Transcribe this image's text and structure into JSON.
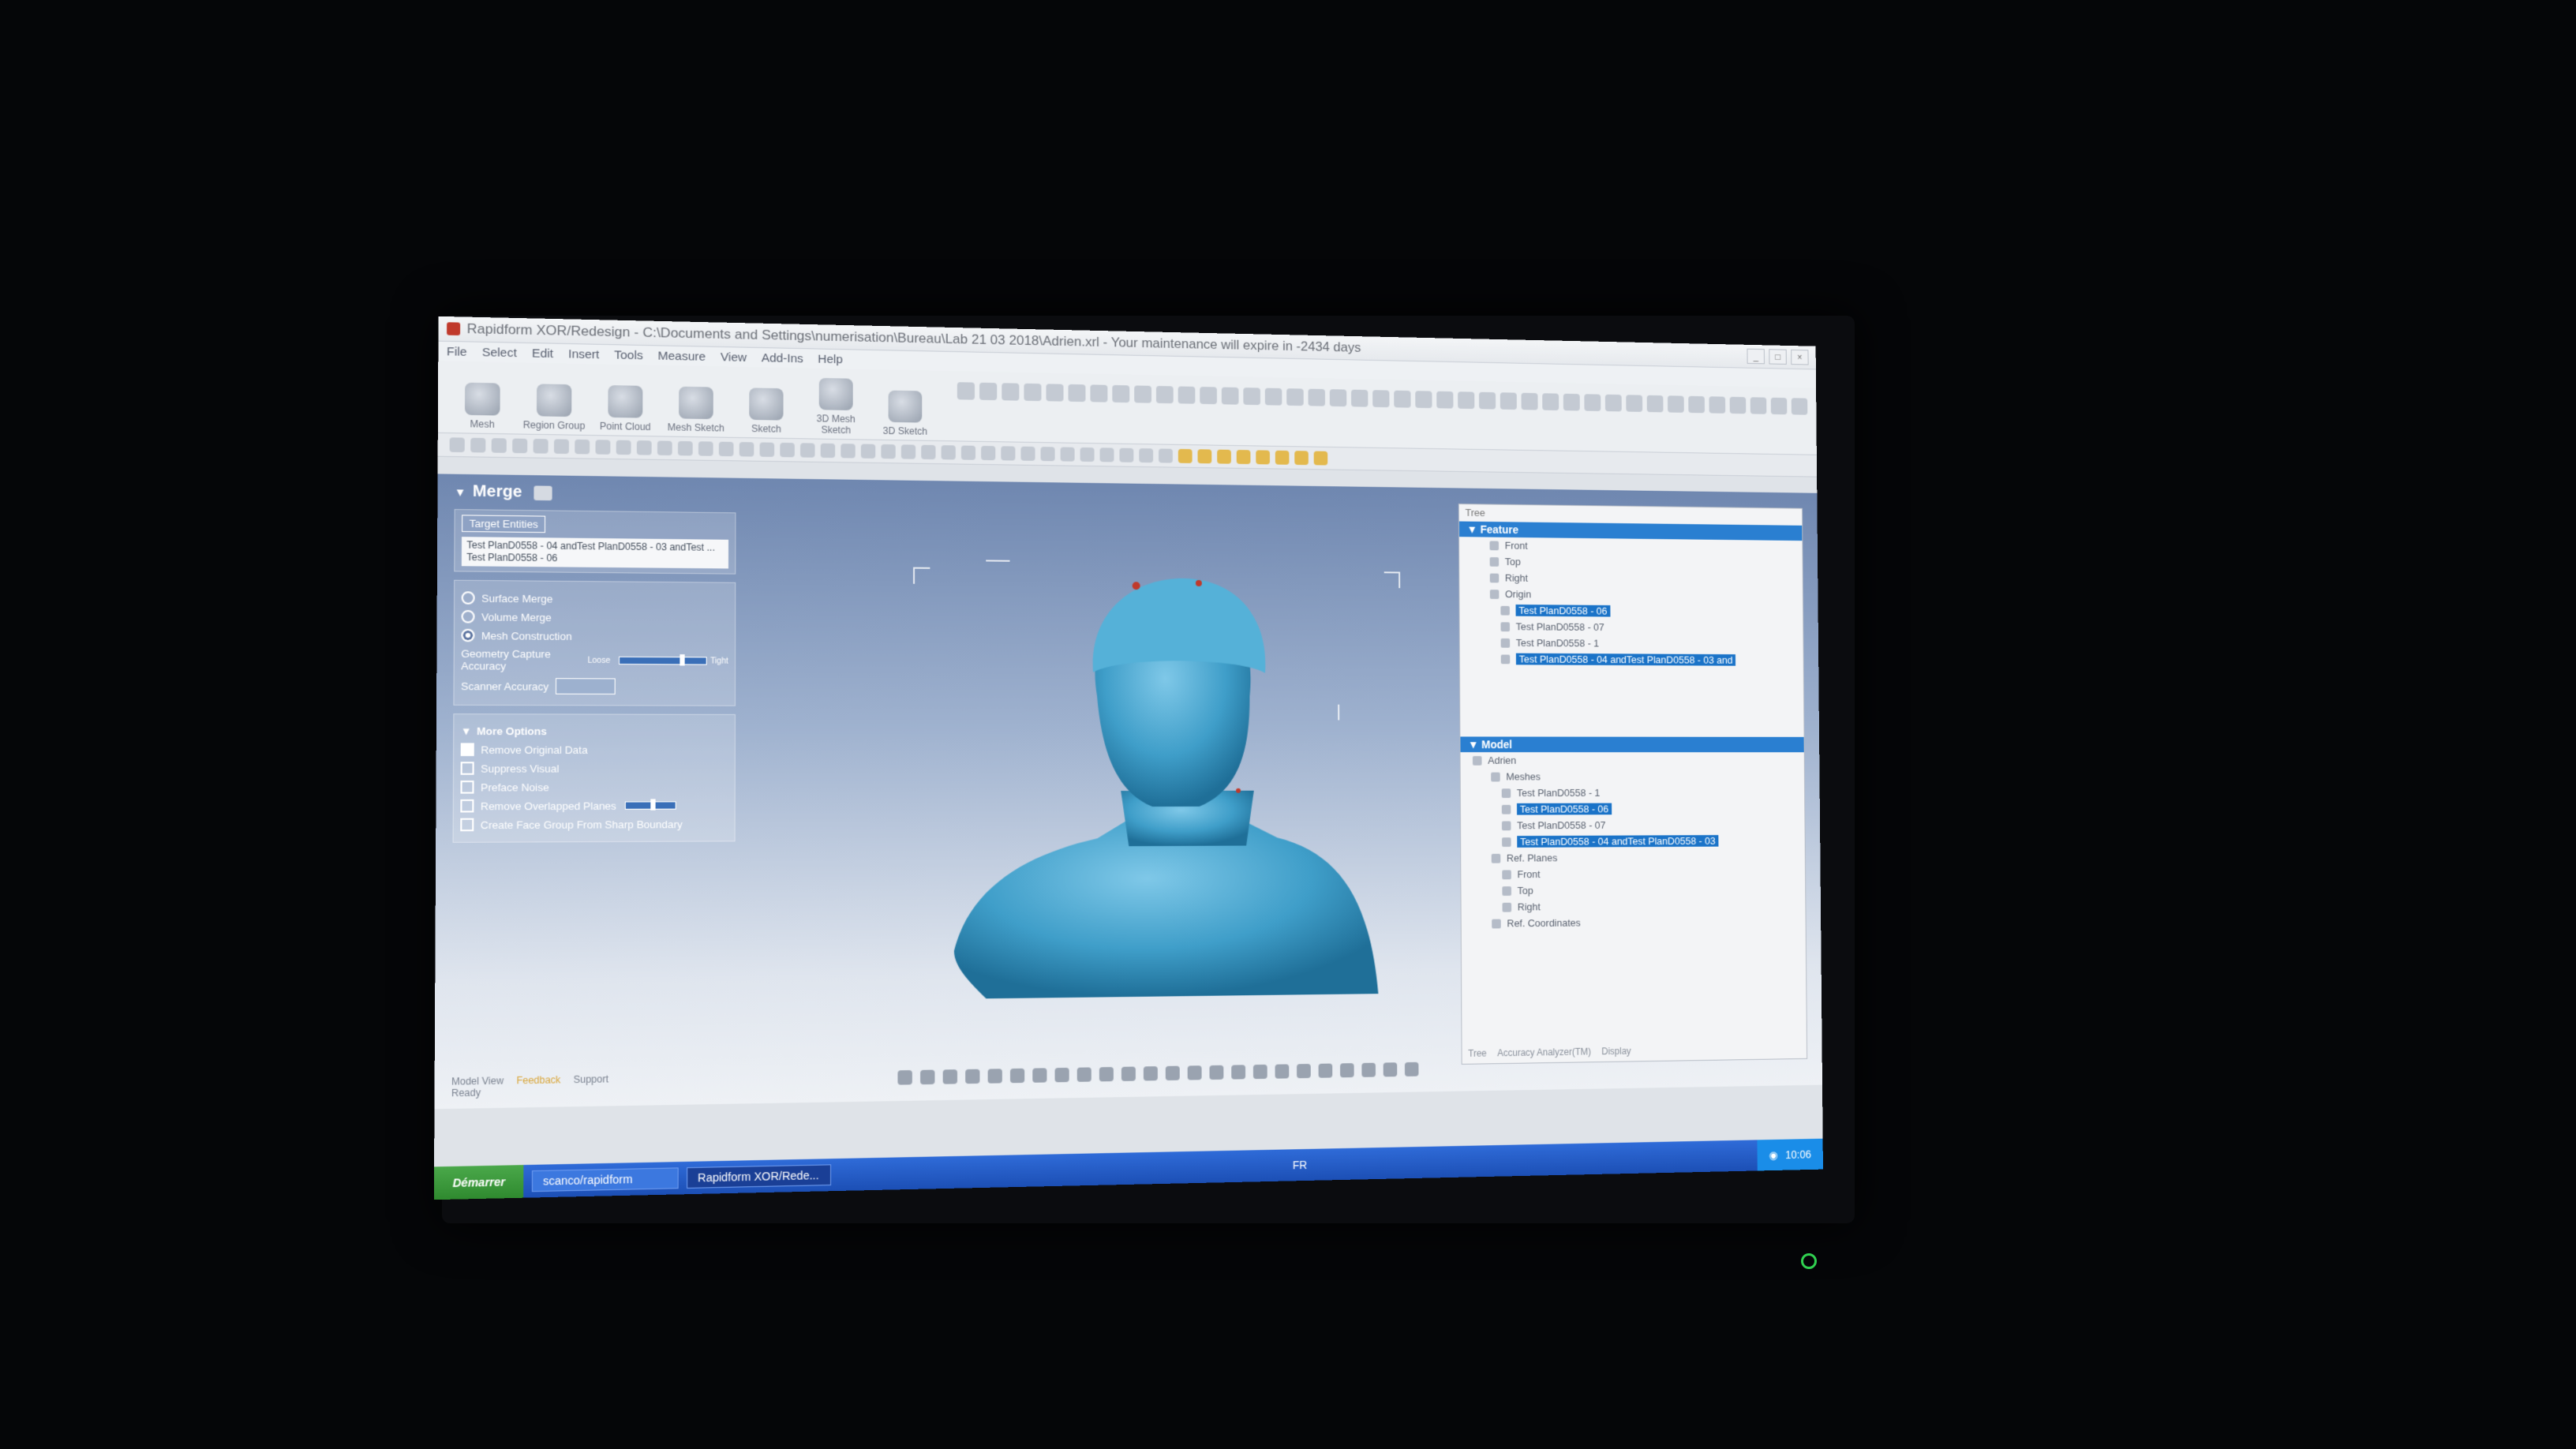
{
  "window": {
    "title": "Rapidform XOR/Redesign - C:\\Documents and Settings\\numerisation\\Bureau\\Lab 21 03 2018\\Adrien.xrl - Your maintenance will expire in -2434 days"
  },
  "menu": [
    "File",
    "Select",
    "Edit",
    "Insert",
    "Tools",
    "Measure",
    "View",
    "Add-Ins",
    "Help"
  ],
  "ribbon": {
    "buttons": [
      "Mesh",
      "Region Group",
      "Point Cloud",
      "Mesh Sketch",
      "Sketch",
      "3D Mesh Sketch",
      "3D Sketch"
    ]
  },
  "merge_panel": {
    "title": "Merge",
    "target_chip": "Target Entities",
    "target_list": [
      "Test PlanD0558 - 04 andTest PlanD0558 - 03 andTest ...",
      "Test PlanD0558 - 06"
    ],
    "methods": [
      {
        "label": "Surface Merge",
        "selected": false
      },
      {
        "label": "Volume Merge",
        "selected": false
      },
      {
        "label": "Mesh Construction",
        "selected": true
      }
    ],
    "geometry_accuracy_label": "Geometry Capture Accuracy",
    "geometry_accuracy_low": "Loose",
    "geometry_accuracy_high": "Tight",
    "geometry_accuracy_value": 0.7,
    "scanner_accuracy_label": "Scanner Accuracy",
    "more_options": "More Options",
    "options": [
      {
        "label": "Remove Original Data",
        "checked": true
      },
      {
        "label": "Suppress Visual",
        "checked": false
      },
      {
        "label": "Preface Noise",
        "checked": false
      },
      {
        "label": "Remove Overlapped Planes",
        "checked": false
      },
      {
        "label": "Create Face Group From Sharp Boundary",
        "checked": false
      }
    ]
  },
  "tree": {
    "tab": "Tree",
    "feature_header": "Feature",
    "feature_items": [
      {
        "label": "Front",
        "selected": false,
        "level": 1
      },
      {
        "label": "Top",
        "selected": false,
        "level": 1
      },
      {
        "label": "Right",
        "selected": false,
        "level": 1
      },
      {
        "label": "Origin",
        "selected": false,
        "level": 1
      },
      {
        "label": "Test PlanD0558 - 06",
        "selected": true,
        "level": 2
      },
      {
        "label": "Test PlanD0558 - 07",
        "selected": false,
        "level": 2
      },
      {
        "label": "Test PlanD0558 - 1",
        "selected": false,
        "level": 2
      },
      {
        "label": "Test PlanD0558 - 04 andTest PlanD0558 - 03 and",
        "selected": true,
        "level": 2
      }
    ],
    "model_header": "Model",
    "model_items": [
      {
        "label": "Adrien",
        "selected": false,
        "level": 0
      },
      {
        "label": "Meshes",
        "selected": false,
        "level": 1
      },
      {
        "label": "Test PlanD0558 - 1",
        "selected": false,
        "level": 2
      },
      {
        "label": "Test PlanD0558 - 06",
        "selected": true,
        "level": 2
      },
      {
        "label": "Test PlanD0558 - 07",
        "selected": false,
        "level": 2
      },
      {
        "label": "Test PlanD0558 - 04 andTest PlanD0558 - 03",
        "selected": true,
        "level": 2
      },
      {
        "label": "Ref. Planes",
        "selected": false,
        "level": 1
      },
      {
        "label": "Front",
        "selected": false,
        "level": 2
      },
      {
        "label": "Top",
        "selected": false,
        "level": 2
      },
      {
        "label": "Right",
        "selected": false,
        "level": 2
      },
      {
        "label": "Ref. Coordinates",
        "selected": false,
        "level": 1
      }
    ],
    "footer_tabs": [
      "Tree",
      "Accuracy Analyzer(TM)",
      "Display"
    ]
  },
  "bottom_tabs": [
    "Model View",
    "Feedback",
    "Support"
  ],
  "bottom_tab_active": 1,
  "status_left": "Ready",
  "taskbar": {
    "start": "Démarrer",
    "tasks": [
      "scanco/rapidform",
      "Rapidform XOR/Rede..."
    ],
    "language": "FR",
    "clock": "10:06"
  },
  "colors": {
    "selection": "#1a73c8",
    "mesh": "#3f9ec9",
    "taskbar": "#2459c8",
    "start": "#3c9a3c"
  }
}
